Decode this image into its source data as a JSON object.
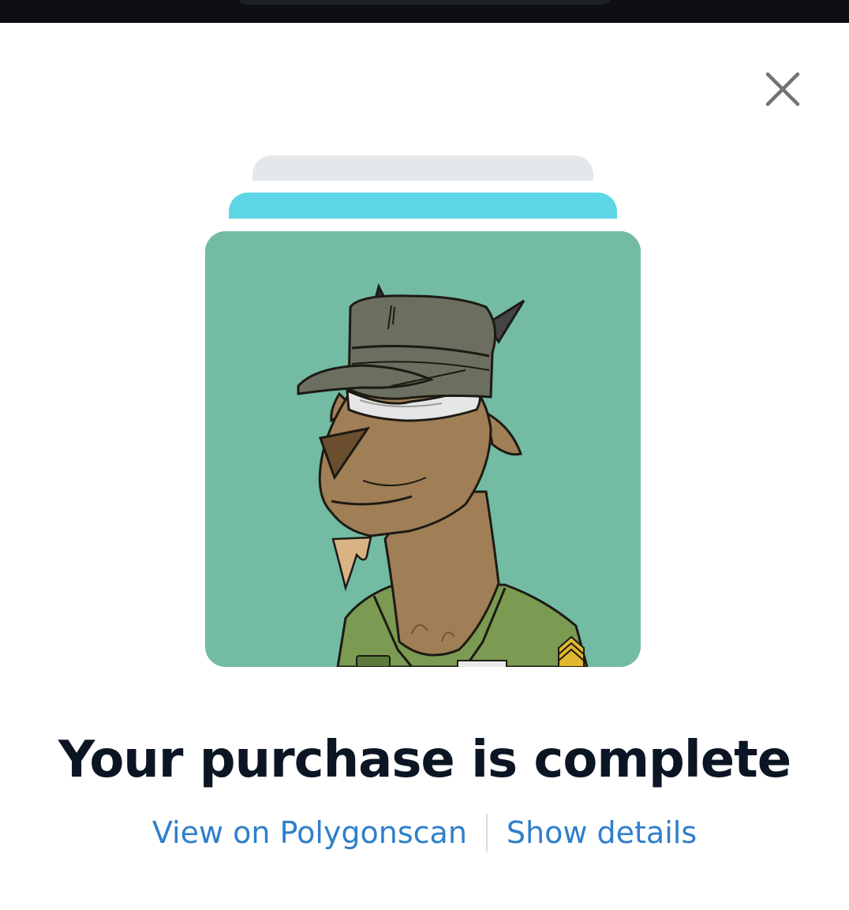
{
  "status_bar": {},
  "dialog": {
    "close_icon": "close-icon",
    "nft_image_alt_icon": "goat-soldier-artwork",
    "title": "Your purchase is complete",
    "links": {
      "view_explorer": "View on Polygonscan",
      "show_details": "Show details"
    }
  },
  "colors": {
    "card_background": "#73bba3",
    "stack_top": "#5dd6e6",
    "stack_back": "#e5e8eb",
    "link": "#2f7fcb",
    "title": "#0c1523"
  }
}
